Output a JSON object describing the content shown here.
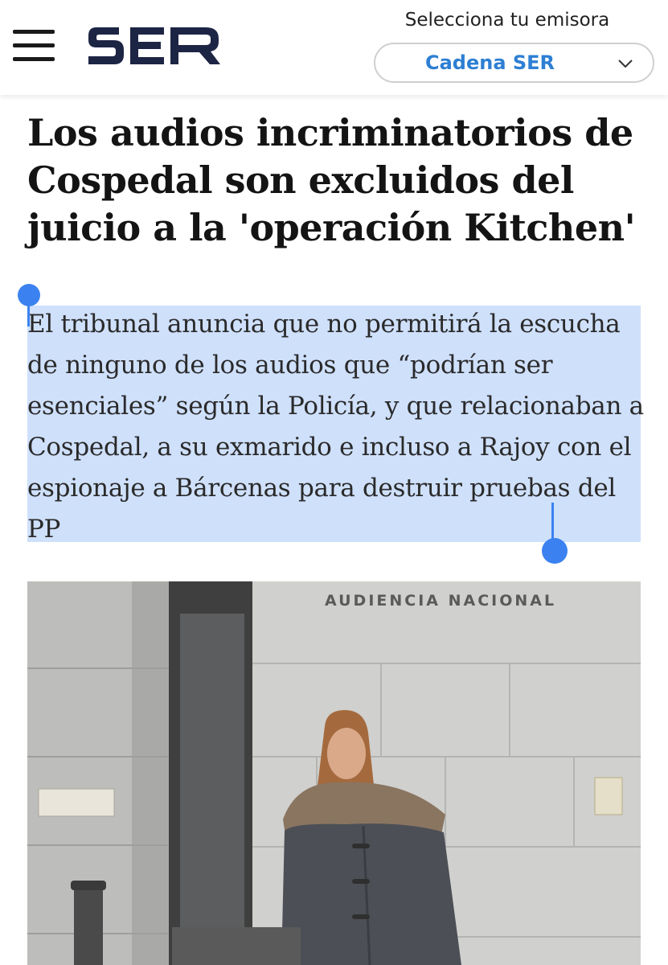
{
  "header": {
    "menu_icon": "hamburger-menu-icon",
    "logo_alt": "SER",
    "station_label": "Selecciona tu emisora",
    "station_value": "Cadena SER",
    "station_chevron_icon": "chevron-down-icon",
    "accent_color": "#2d7fd3"
  },
  "article": {
    "headline": "Los audios incriminatorios de Cospedal son excluidos del juicio a la 'operación Kitchen'",
    "subtitle": "El tribunal anuncia que no permitirá la escucha de ninguno de los audios que “podrían ser esenciales” según la Policía, y que relacionaban a Cospedal, a su exmarido e incluso a Rajoy con el espionaje a Bárcenas para destruir pruebas del PP",
    "selection_color": "#cfe0fb",
    "photo_sign": "AUDIENCIA NACIONAL"
  }
}
